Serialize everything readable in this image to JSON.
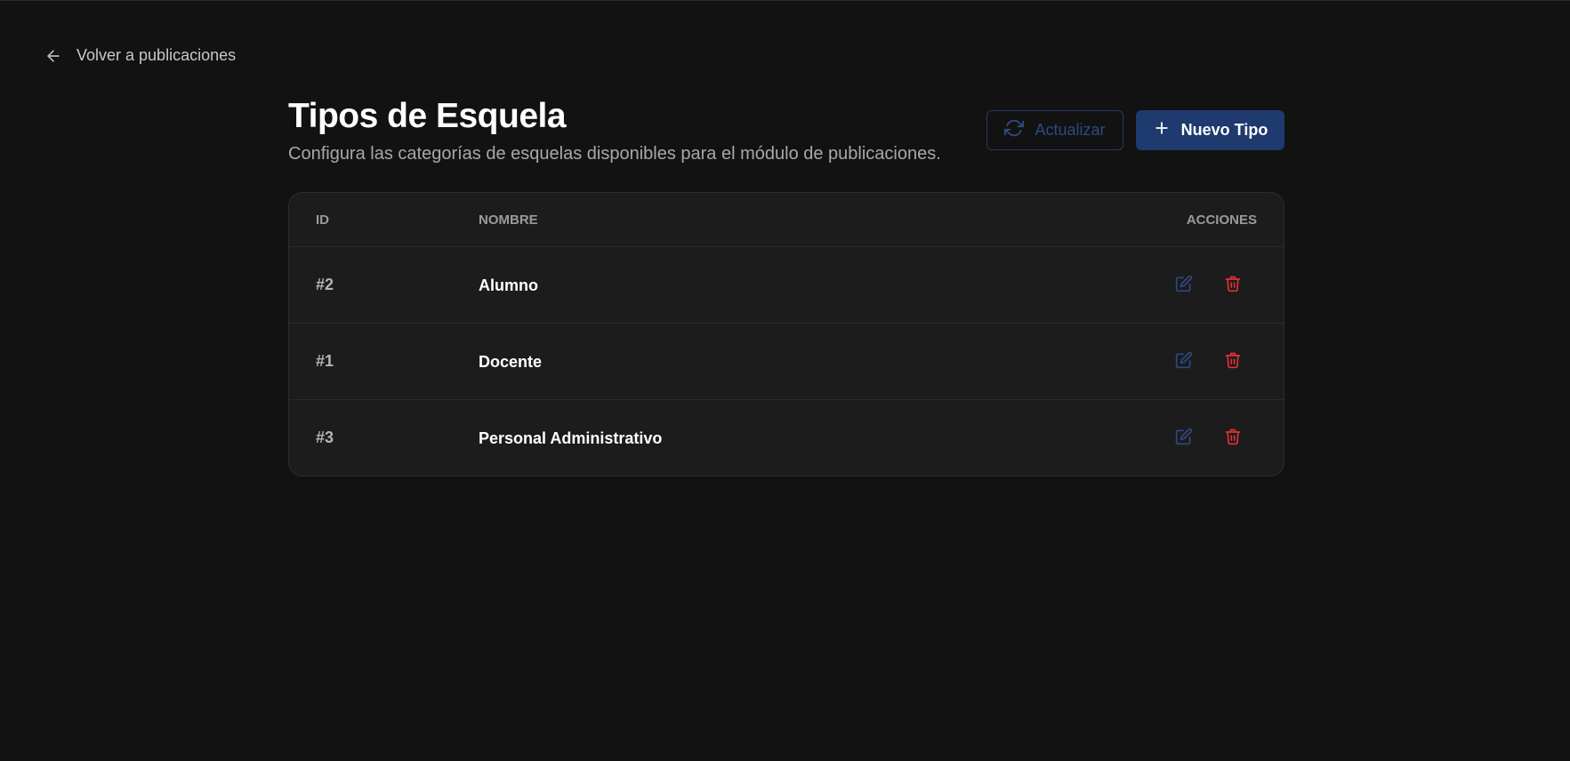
{
  "nav": {
    "back_label": "Volver a publicaciones"
  },
  "header": {
    "title": "Tipos de Esquela",
    "subtitle": "Configura las categorías de esquelas disponibles para el módulo de publicaciones."
  },
  "toolbar": {
    "refresh_label": "Actualizar",
    "new_label": "Nuevo Tipo"
  },
  "table": {
    "columns": {
      "id": "ID",
      "name": "NOMBRE",
      "actions": "ACCIONES"
    },
    "rows": [
      {
        "id": "#2",
        "name": "Alumno"
      },
      {
        "id": "#1",
        "name": "Docente"
      },
      {
        "id": "#3",
        "name": "Personal Administrativo"
      }
    ]
  },
  "icons": {
    "back": "arrow-left-icon",
    "refresh": "refresh-icon",
    "new": "plus-icon",
    "edit": "edit-icon",
    "delete": "trash-icon"
  },
  "colors": {
    "background": "#121212",
    "primary": "#1e3a6e",
    "edit": "#2e4a82",
    "delete": "#e0303a"
  }
}
